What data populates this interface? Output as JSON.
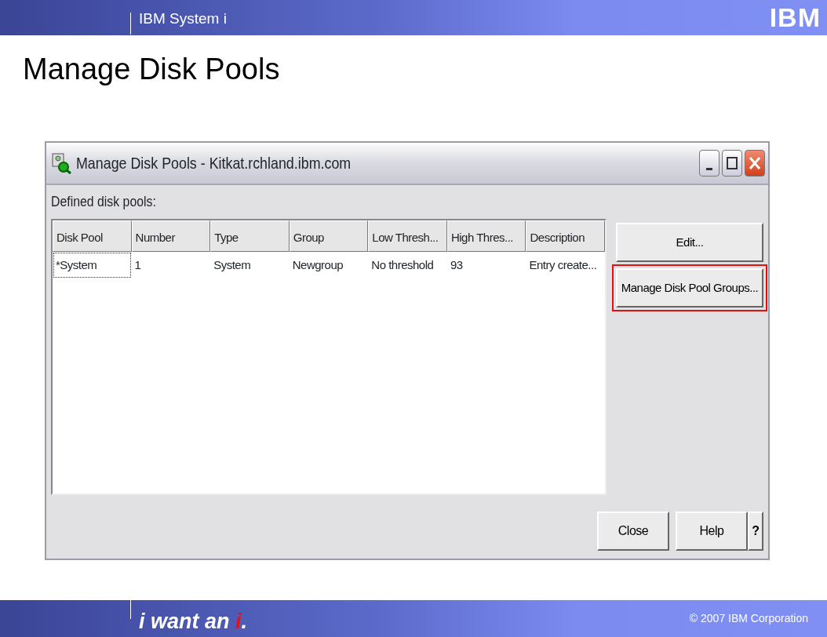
{
  "header": {
    "product": "IBM System i",
    "logo": "IBM"
  },
  "slide_title": "Manage Disk Pools",
  "window": {
    "title": "Manage Disk Pools - Kitkat.rchland.ibm.com",
    "list_label": "Defined disk pools:",
    "table": {
      "columns": [
        "Disk Pool",
        "Number",
        "Type",
        "Group",
        "Low Thresh...",
        "High Thres...",
        "Description"
      ],
      "rows": [
        {
          "cells": [
            "*System",
            "1",
            "System",
            "Newgroup",
            "No threshold",
            "93",
            "Entry create..."
          ],
          "focused": true
        }
      ]
    },
    "side_buttons": [
      {
        "label": "Edit...",
        "highlighted": false
      },
      {
        "label": "Manage Disk Pool Groups...",
        "highlighted": true
      }
    ],
    "bottom_buttons": [
      {
        "label": "Close",
        "kind": "wide"
      },
      {
        "label": "Help",
        "kind": "wide"
      },
      {
        "label": "?",
        "kind": "narrow"
      }
    ]
  },
  "footer": {
    "tagline": [
      {
        "text": "i want an ",
        "accent": false
      },
      {
        "text": "i",
        "accent": true
      },
      {
        "text": ".",
        "accent": false
      }
    ],
    "copyright": "© 2007 IBM Corporation"
  }
}
